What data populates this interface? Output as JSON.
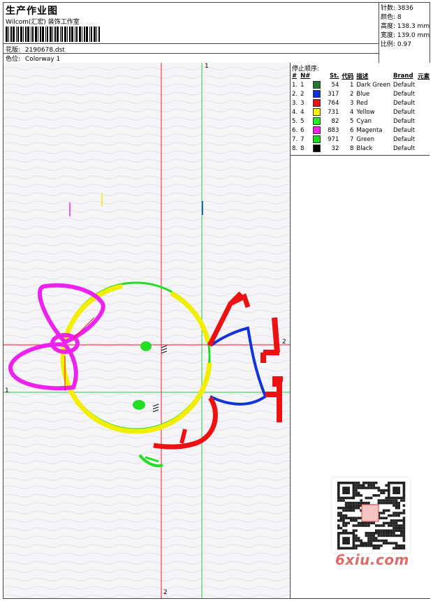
{
  "header": {
    "title": "生产作业图",
    "company": "Wilcom(汇宏) 装饰工作室",
    "design_label": "花版:",
    "design_value": "2190678.dst",
    "colorway_label": "色位:",
    "colorway_value": "Colorway 1"
  },
  "stats": [
    {
      "label": "针数:",
      "value": "3836"
    },
    {
      "label": "颜色:",
      "value": "8"
    },
    {
      "label": "高度:",
      "value": "138.3 mm"
    },
    {
      "label": "宽度:",
      "value": "139.0 mm"
    },
    {
      "label": "比例:",
      "value": "0.97"
    }
  ],
  "stop_sequence": {
    "title": "停止顺序:",
    "columns": [
      "#",
      "N#",
      "St.",
      "代码",
      "描述",
      "Brand",
      "元素"
    ],
    "rows": [
      {
        "num": "1.",
        "n": "1",
        "color": "#1e7a2e",
        "st": "54",
        "code": "1",
        "desc": "Dark Green",
        "brand": "Default"
      },
      {
        "num": "2.",
        "n": "2",
        "color": "#1030e0",
        "st": "317",
        "code": "2",
        "desc": "Blue",
        "brand": "Default"
      },
      {
        "num": "3.",
        "n": "3",
        "color": "#ee1010",
        "st": "764",
        "code": "3",
        "desc": "Red",
        "brand": "Default"
      },
      {
        "num": "4.",
        "n": "4",
        "color": "#f4f000",
        "st": "731",
        "code": "4",
        "desc": "Yellow",
        "brand": "Default"
      },
      {
        "num": "5.",
        "n": "5",
        "color": "#20f020",
        "st": "82",
        "code": "5",
        "desc": "Cyan",
        "brand": "Default"
      },
      {
        "num": "6.",
        "n": "6",
        "color": "#f020f0",
        "st": "883",
        "code": "6",
        "desc": "Magenta",
        "brand": "Default"
      },
      {
        "num": "7.",
        "n": "7",
        "color": "#18e018",
        "st": "971",
        "code": "7",
        "desc": "Green",
        "brand": "Default"
      },
      {
        "num": "8.",
        "n": "8",
        "color": "#000000",
        "st": "32",
        "code": "8",
        "desc": "Black",
        "brand": "Default"
      }
    ]
  },
  "canvas": {
    "guide_labels": {
      "v_green": "1",
      "h_green": "1",
      "h_red": "2",
      "v_red": "2"
    }
  },
  "watermark": {
    "site": "6xiu.com"
  },
  "colors": {
    "yellow": "#f2ee00",
    "magenta": "#ee22ee",
    "red": "#ee1111",
    "blue": "#1133dd",
    "green": "#22dd22",
    "red_guide": "#e8202a",
    "green_guide": "#22cc44"
  }
}
